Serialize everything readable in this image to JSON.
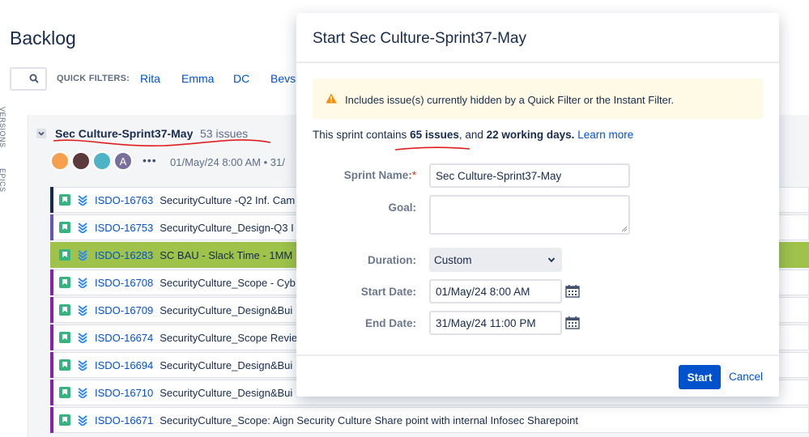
{
  "backlog": {
    "title": "Backlog",
    "quick_filters_label": "QUICK FILTERS:",
    "quick_filters": [
      "Rita",
      "Emma",
      "DC",
      "Bevs"
    ],
    "side_tabs": [
      "VERSIONS",
      "EPICS"
    ],
    "sprint": {
      "name": "Sec Culture-Sprint37-May",
      "issue_count": "53 issues",
      "avatar_letter": "A",
      "more": "•••",
      "dates": "01/May/24 8:00 AM • 31/"
    },
    "issues": [
      {
        "key": "ISDO-16763",
        "summary": "SecurityCulture -Q2 Inf. Cam",
        "bar": "#172b4d"
      },
      {
        "key": "ISDO-16753",
        "summary": "SecurityCulture_Design-Q3 I",
        "bar": "#6554c0"
      },
      {
        "key": "ISDO-16283",
        "summary": "SC BAU - Slack Time - 1MM",
        "bar": "#9ec24a"
      },
      {
        "key": "ISDO-16708",
        "summary": "SecurityCulture_Scope - Cyb",
        "bar": "#8b1fb3"
      },
      {
        "key": "ISDO-16709",
        "summary": "SecurityCulture_Design&Bui",
        "bar": "#8b1fb3"
      },
      {
        "key": "ISDO-16674",
        "summary": "SecurityCulture_Scope Revie",
        "bar": "#8b1fb3"
      },
      {
        "key": "ISDO-16694",
        "summary": "SecurityCulture_Design&Bui",
        "bar": "#8b1fb3"
      },
      {
        "key": "ISDO-16710",
        "summary": "SecurityCulture_Design&Bui",
        "bar": "#8b1fb3"
      },
      {
        "key": "ISDO-16671",
        "summary": "SecurityCulture_Scope: Aign Security Culture Share point with internal Infosec Sharepoint",
        "bar": "#8b1fb3"
      }
    ]
  },
  "modal": {
    "title": "Start Sec Culture-Sprint37-May",
    "warning": "Includes issue(s) currently hidden by a Quick Filter or the Instant Filter.",
    "info": {
      "prefix": "This sprint contains ",
      "issues": "65 issues",
      "middle": ", and ",
      "days": "22 working days.",
      "link": "Learn more"
    },
    "fields": {
      "sprint_name_label": "Sprint Name:",
      "required_mark": "*",
      "sprint_name_value": "Sec Culture-Sprint37-May",
      "goal_label": "Goal:",
      "goal_value": "",
      "duration_label": "Duration:",
      "duration_value": "Custom",
      "start_date_label": "Start Date:",
      "start_date_value": "01/May/24 8:00 AM",
      "end_date_label": "End Date:",
      "end_date_value": "31/May/24 11:00 PM"
    },
    "buttons": {
      "start": "Start",
      "cancel": "Cancel"
    }
  },
  "colors": {
    "accent": "#0052cc",
    "warning_bg": "#fffae6",
    "warning_icon": "#ff8b00",
    "annotation_red": "#e01e1e",
    "highlight_row": "#9ec24a"
  }
}
